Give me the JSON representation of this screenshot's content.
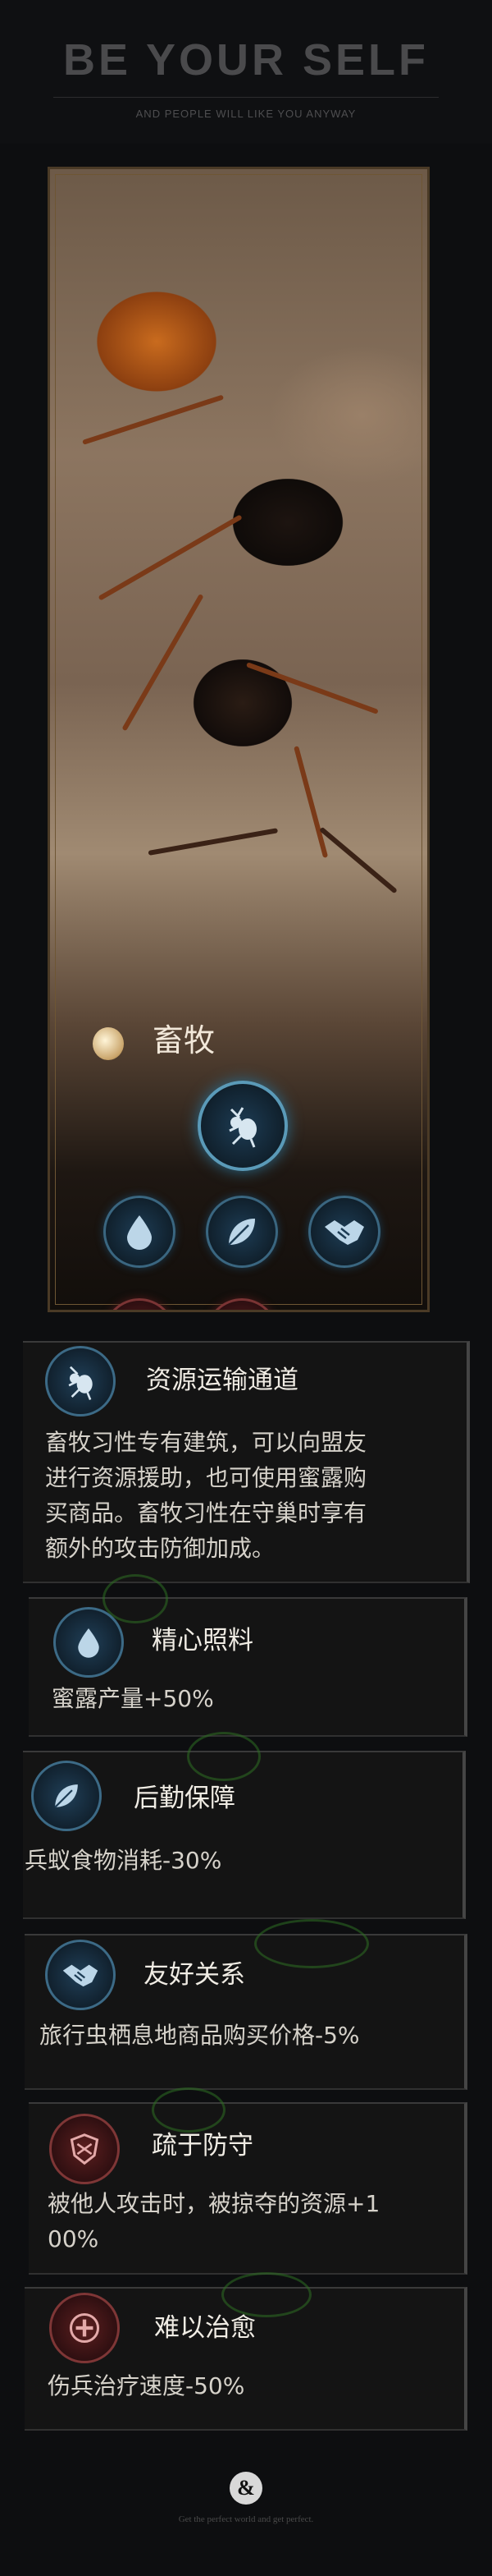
{
  "header": {
    "title": "BE YOUR SELF",
    "subtitle": "AND PEOPLE WILL LIKE YOU ANYWAY"
  },
  "card": {
    "skill_icon": "pill-icon",
    "skill_name": "畜牧",
    "main_button_icon": "ant-icon",
    "buttons": [
      {
        "icon": "water-drop-icon",
        "color": "blue"
      },
      {
        "icon": "leaf-icon",
        "color": "blue"
      },
      {
        "icon": "handshake-icon",
        "color": "blue"
      },
      {
        "icon": "shield-icon",
        "color": "red"
      },
      {
        "icon": "plus-cross-icon",
        "color": "red"
      }
    ]
  },
  "traits": [
    {
      "icon": "ant-icon",
      "title": "资源运输通道",
      "lines": [
        "畜牧习性专有建筑，可以向盟友",
        "进行资源援助，也可使用蜜露购",
        "买商品。畜牧习性在守巢时享有",
        "额外的攻击防御加成。"
      ]
    },
    {
      "icon": "water-drop-icon",
      "title": "精心照料",
      "lines": [
        "蜜露产量+50%"
      ]
    },
    {
      "icon": "leaf-icon",
      "title": "后勤保障",
      "lines": [
        "兵蚁食物消耗-30%"
      ]
    },
    {
      "icon": "handshake-icon",
      "title": "友好关系",
      "lines": [
        "旅行虫栖息地商品购买价格-5%"
      ]
    },
    {
      "icon": "shield-icon",
      "title": "疏于防守",
      "lines": [
        "被他人攻击时，被掠夺的资源+1",
        "00%"
      ]
    },
    {
      "icon": "plus-cross-icon",
      "title": "难以治愈",
      "lines": [
        "伤兵治疗速度-50%"
      ]
    }
  ],
  "footer": {
    "mark": "&",
    "text": "Get the perfect world and get perfect."
  },
  "colors": {
    "background": "#0d0e10",
    "blue_ring": "#3c6a86",
    "red_ring": "#7e3636",
    "frame": "#4a3a26"
  }
}
